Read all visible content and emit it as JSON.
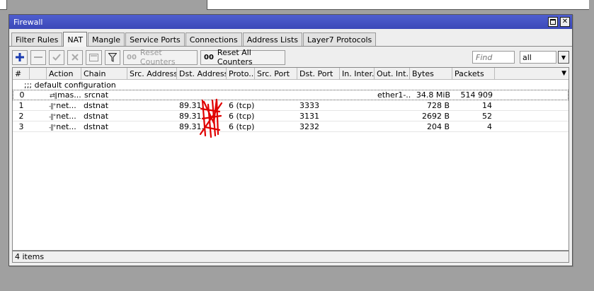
{
  "window": {
    "title": "Firewall"
  },
  "tabs": [
    {
      "label": "Filter Rules",
      "active": false
    },
    {
      "label": "NAT",
      "active": true
    },
    {
      "label": "Mangle",
      "active": false
    },
    {
      "label": "Service Ports",
      "active": false
    },
    {
      "label": "Connections",
      "active": false
    },
    {
      "label": "Address Lists",
      "active": false
    },
    {
      "label": "Layer7 Protocols",
      "active": false
    }
  ],
  "toolbar": {
    "reset_counters": "Reset Counters",
    "reset_all_counters": "Reset All Counters",
    "find_placeholder": "Find",
    "filter_value": "all"
  },
  "columns": [
    "#",
    "",
    "Action",
    "Chain",
    "Src. Address",
    "Dst. Address",
    "Proto...",
    "Src. Port",
    "Dst. Port",
    "In. Inter...",
    "Out. Int...",
    "Bytes",
    "Packets"
  ],
  "comment": ";;; default configuration",
  "rows": [
    {
      "num": "0",
      "action": "mas...",
      "chain": "srcnat",
      "src": "",
      "dst": "",
      "proto": "",
      "src_port": "",
      "dst_port": "",
      "in": "",
      "out": "ether1-...",
      "bytes": "34.8 MiB",
      "packets": "514 909"
    },
    {
      "num": "1",
      "action": "net...",
      "chain": "dstnat",
      "src": "",
      "dst": "89.31.",
      "proto": "6 (tcp)",
      "src_port": "",
      "dst_port": "3333",
      "in": "",
      "out": "",
      "bytes": "728 B",
      "packets": "14"
    },
    {
      "num": "2",
      "action": "net...",
      "chain": "dstnat",
      "src": "",
      "dst": "89.31.",
      "proto": "6 (tcp)",
      "src_port": "",
      "dst_port": "3131",
      "in": "",
      "out": "",
      "bytes": "2692 B",
      "packets": "52"
    },
    {
      "num": "3",
      "action": "net...",
      "chain": "dstnat",
      "src": "",
      "dst": "89.31.",
      "proto": "6 (tcp)",
      "src_port": "",
      "dst_port": "3232",
      "in": "",
      "out": "",
      "bytes": "204 B",
      "packets": "4"
    }
  ],
  "status": {
    "items": "4 items"
  },
  "colors": {
    "titlebar": "#4451c4",
    "scribble": "#e00000"
  }
}
